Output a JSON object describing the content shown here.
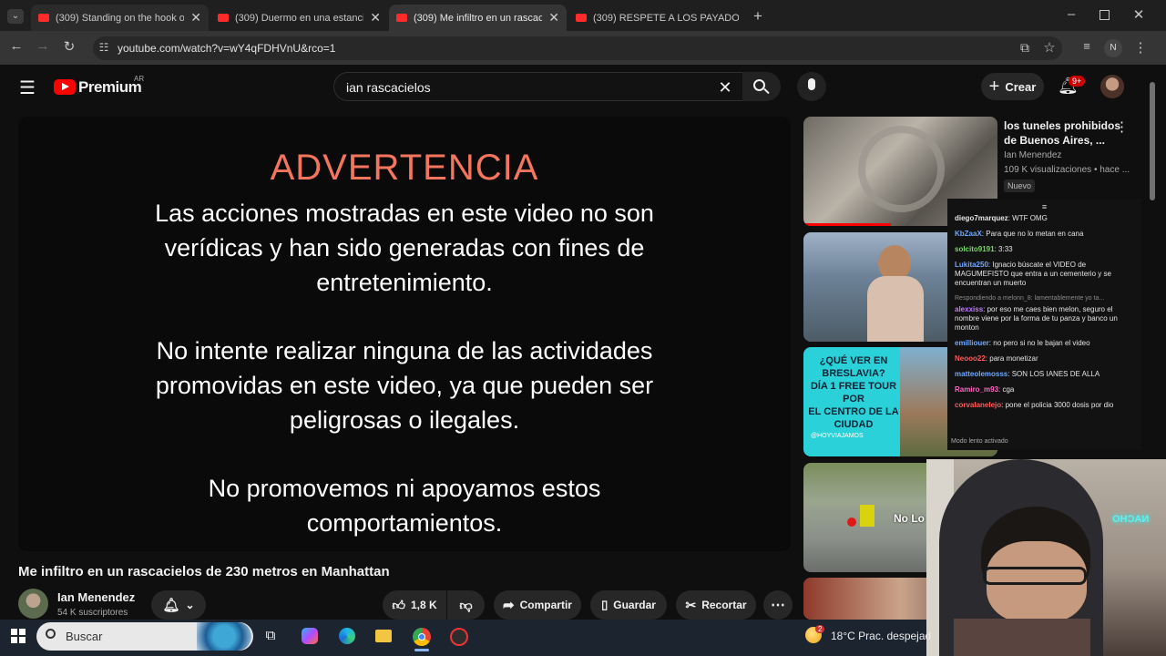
{
  "browser": {
    "tabs": [
      {
        "title": "(309) Standing on the hook of a"
      },
      {
        "title": "(309) Duermo en una estancia a"
      },
      {
        "title": "(309) Me infiltro en un rascacie"
      },
      {
        "title": "(309) RESPETE A LOS PAYADOR"
      }
    ],
    "url": "youtube.com/watch?v=wY4qFDHVnU&rco=1",
    "profile_initial": "N"
  },
  "youtube": {
    "logo_text": "Premium",
    "region": "AR",
    "search_value": "ian rascacielos",
    "create_label": "Crear",
    "notif_count": "9+"
  },
  "video": {
    "warning_title": "ADVERTENCIA",
    "para1_l1": "Las acciones mostradas en este video no son",
    "para1_l2": "verídicas y han sido generadas con fines de",
    "para1_l3": "entretenimiento.",
    "para2_l1": "No intente realizar ninguna de las actividades",
    "para2_l2": "promovidas en este video, ya que pueden ser",
    "para2_l3": "peligrosas o ilegales.",
    "para3_l1": "No promovemos ni apoyamos estos",
    "para3_l2": "comportamientos.",
    "title": "Me infiltro en un rascacielos de 230 metros en Manhattan",
    "channel": "Ian Menendez",
    "subs": "54 K suscriptores",
    "likes": "1,8 K",
    "share": "Compartir",
    "save": "Guardar",
    "clip": "Recortar"
  },
  "recommendation": {
    "title_l1": "los tuneles prohibidos",
    "title_l2": "de Buenos Aires, ...",
    "channel": "Ian Menendez",
    "meta": "109 K visualizaciones • hace ...",
    "badge": "Nuevo",
    "thumb3_l1": "¿QUÉ VER EN",
    "thumb3_l2": "BRESLAVIA?",
    "thumb3_l3": "DÍA 1 FREE TOUR POR",
    "thumb3_l4": "EL CENTRO DE LA",
    "thumb3_l5": "CIUDAD",
    "thumb3_handle": "@HOYVIAJAMOS",
    "thumb4_text": "No Lo"
  },
  "chat": {
    "messages": [
      {
        "user": "diego7marquez",
        "color": "#e5e5e5",
        "text": "WTF OMG"
      },
      {
        "user": "KbZaaX",
        "color": "#6fa8ff",
        "text": "Para que no lo metan en cana"
      },
      {
        "user": "solcito9191",
        "color": "#7bd66b",
        "text": "3:33"
      },
      {
        "user": "Lukita250",
        "color": "#6fa8ff",
        "text": "Ignacio búscate el VIDEO de MAGUMEFISTO que entra a un cementerio y se encuentran un muerto"
      },
      {
        "user": "alexxiss",
        "color": "#c27bff",
        "text": "por eso me caes bien melon, seguro el nombre viene por la forma de tu panza y banco un monton"
      },
      {
        "user": "emilliouer",
        "color": "#6fa8ff",
        "text": "no pero si no le bajan el video"
      },
      {
        "user": "Neooo22",
        "color": "#ff5a5a",
        "text": "para monetizar"
      },
      {
        "user": "matteolemosss",
        "color": "#6fa8ff",
        "text": "SON LOS IANES DE ALLA"
      },
      {
        "user": "Ramiro_m93",
        "color": "#ff66c4",
        "text": "cga"
      },
      {
        "user": "corvalanelejo",
        "color": "#ff5a5a",
        "text": "pone el policia 3000 dosis por dio"
      }
    ],
    "reply_note": "Respondiendo a melonn_8: lamentablemente yo ta...",
    "footer": "Modo lento activado"
  },
  "overlay": {
    "neon_text": "NACHO"
  },
  "taskbar": {
    "search_placeholder": "Buscar",
    "weather_badge": "2",
    "weather": "18°C  Prac. despejad"
  }
}
